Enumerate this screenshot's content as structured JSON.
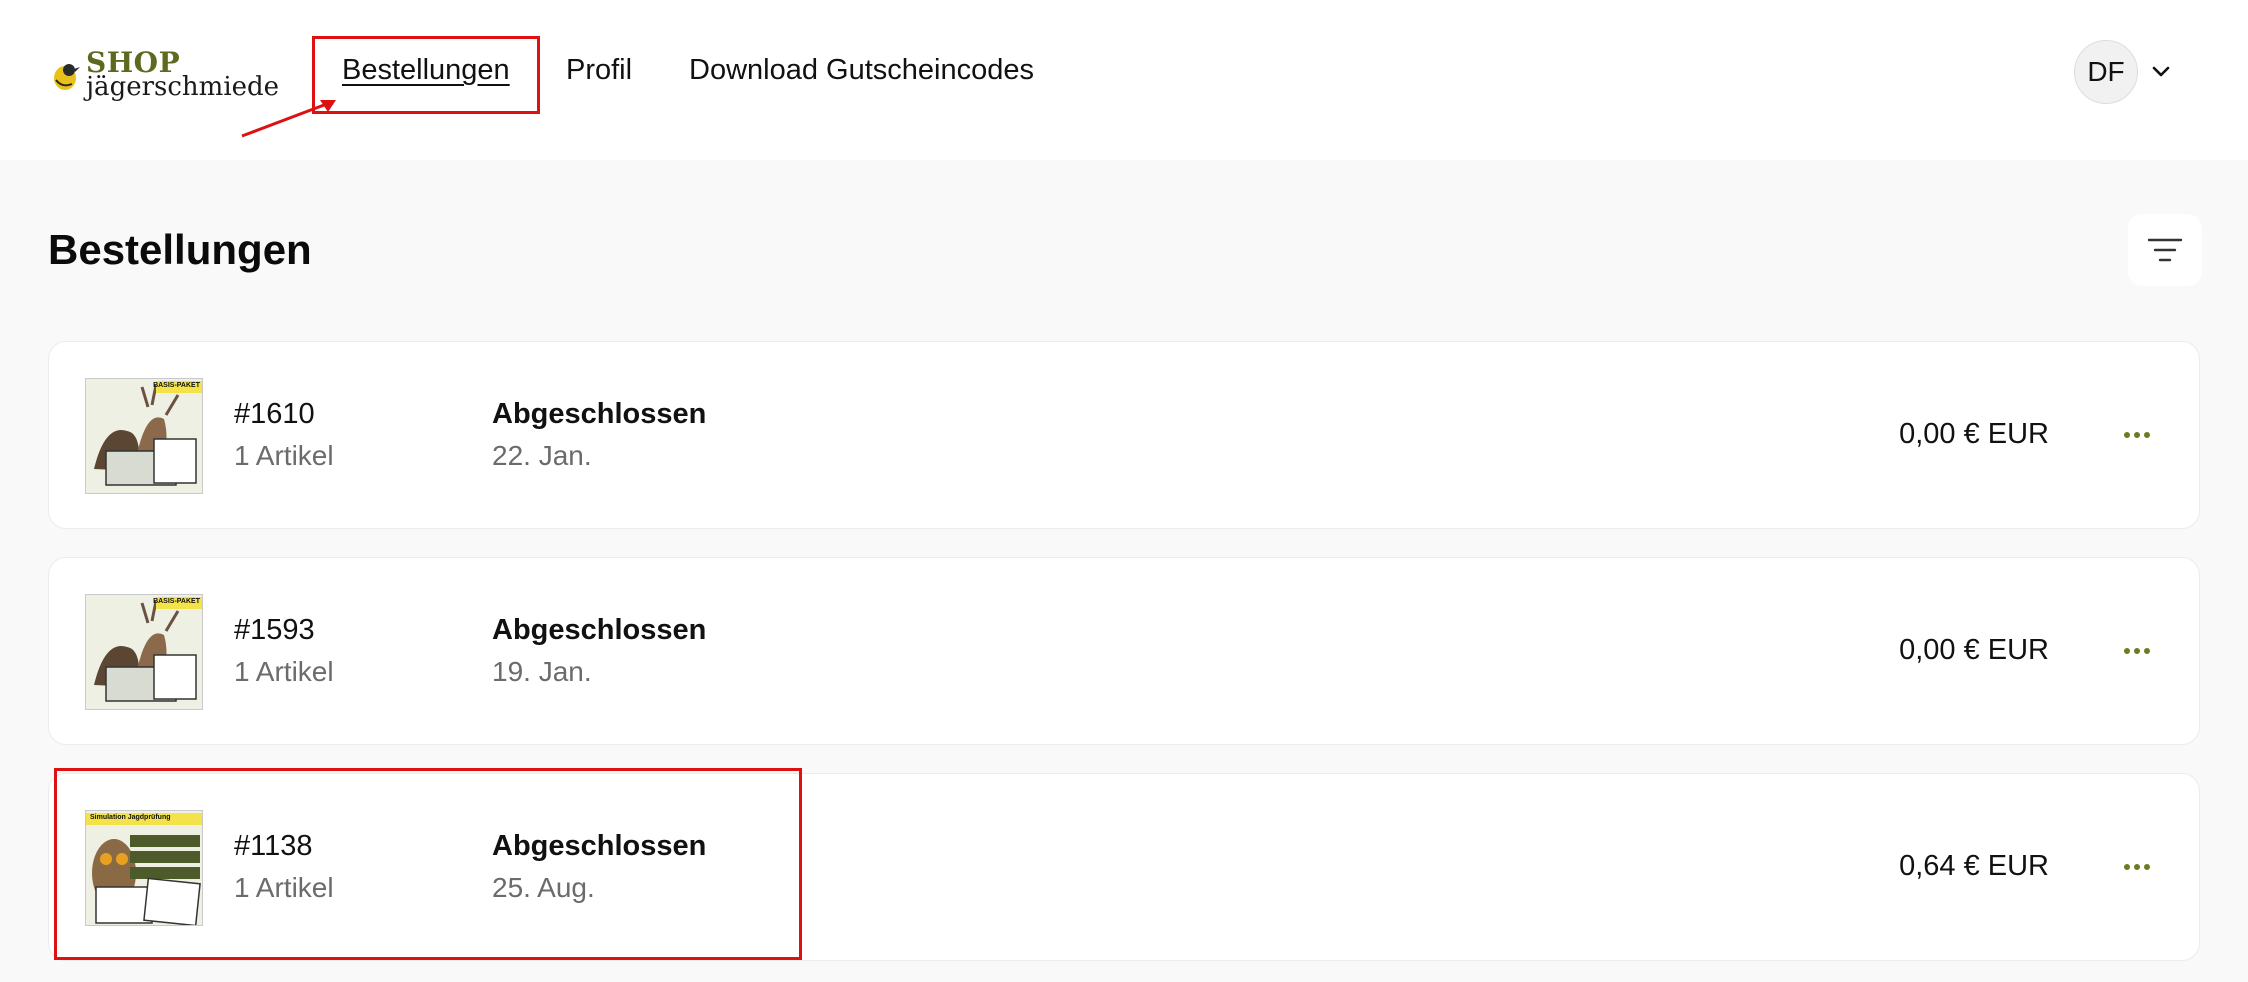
{
  "brand": {
    "shop_label": "SHOP",
    "name": "jägerschmiede",
    "logo_icon": "yellow-bird-mark"
  },
  "nav": {
    "items": [
      {
        "label": "Bestellungen",
        "active": true
      },
      {
        "label": "Profil",
        "active": false
      },
      {
        "label": "Download Gutscheincodes",
        "active": false
      }
    ]
  },
  "account": {
    "initials": "DF",
    "menu_icon": "chevron-down-icon"
  },
  "page": {
    "title": "Bestellungen",
    "filter_icon": "filter-lines-icon"
  },
  "orders": [
    {
      "number": "#1610",
      "items": "1 Artikel",
      "status": "Abgeschlossen",
      "date": "22. Jan.",
      "total": "0,00 € EUR",
      "thumb_badge": "BASIS-PAKET"
    },
    {
      "number": "#1593",
      "items": "1 Artikel",
      "status": "Abgeschlossen",
      "date": "19. Jan.",
      "total": "0,00 € EUR",
      "thumb_badge": "BASIS-PAKET"
    },
    {
      "number": "#1138",
      "items": "1 Artikel",
      "status": "Abgeschlossen",
      "date": "25. Aug.",
      "total": "0,64 € EUR",
      "thumb_badge": "Simulation Jagdprüfung"
    }
  ],
  "colors": {
    "accent": "#6b7d1e",
    "annotation": "#dd1111",
    "page_bg": "#f9f9f9",
    "card_bg": "#ffffff",
    "muted_text": "#6b6b6b"
  }
}
